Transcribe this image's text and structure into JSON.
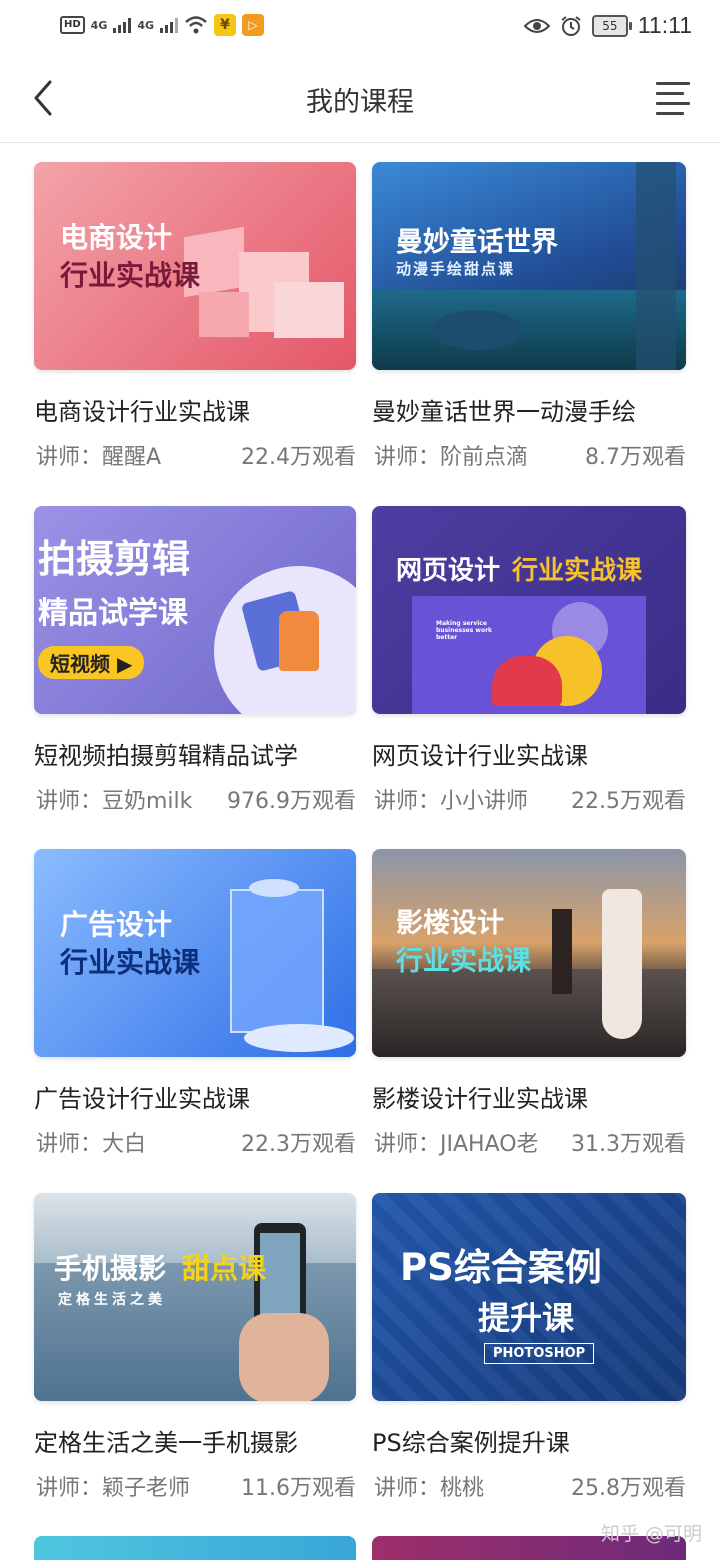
{
  "status_bar": {
    "hd": "HD",
    "sim1": "4G",
    "sim2": "4G",
    "battery": "55",
    "time": "11:11",
    "icons": [
      "hd-icon",
      "signal-icon",
      "wifi-icon",
      "payment-icon",
      "play-icon",
      "eye-icon",
      "alarm-icon",
      "battery-icon"
    ]
  },
  "header": {
    "title": "我的课程",
    "back_icon": "back-arrow-icon",
    "menu_icon": "menu-icon"
  },
  "courses": [
    {
      "title": "电商设计行业实战课",
      "lecturer": "讲师：醒醒A",
      "views": "22.4万观看",
      "thumb": {
        "line1": "电商设计",
        "line2": "行业实战课",
        "colors": [
          "#f08d94",
          "#e75d6c"
        ]
      }
    },
    {
      "title": "曼妙童话世界一动漫手绘",
      "lecturer": "讲师：阶前点滴",
      "views": "8.7万观看",
      "thumb": {
        "line1": "曼妙童话世界",
        "line2": "动漫手绘甜点课",
        "colors": [
          "#2d6fc4",
          "#1a3f7a"
        ]
      }
    },
    {
      "title": "短视频拍摄剪辑精品试学",
      "lecturer": "讲师：豆奶milk",
      "views": "976.9万观看",
      "thumb": {
        "line1": "拍摄剪辑",
        "line2": "精品试学课",
        "badge": "短视频 ▶",
        "colors": [
          "#8d86dc",
          "#6c64c8"
        ]
      }
    },
    {
      "title": "网页设计行业实战课",
      "lecturer": "讲师：小小讲师",
      "views": "22.5万观看",
      "thumb": {
        "line1a": "网页设计",
        "line1b": "行业实战课",
        "mock_text": "Making service businesses work better",
        "colors": [
          "#4a3c9a",
          "#3a2d85"
        ]
      }
    },
    {
      "title": "广告设计行业实战课",
      "lecturer": "讲师：大白",
      "views": "22.3万观看",
      "thumb": {
        "line1": "广告设计",
        "line2": "行业实战课",
        "colors": [
          "#6aa6ff",
          "#2d70e6"
        ]
      }
    },
    {
      "title": "影楼设计行业实战课",
      "lecturer": "讲师：JIAHAO老",
      "views": "31.3万观看",
      "thumb": {
        "line1": "影楼设计",
        "line2": "行业实战课",
        "colors": [
          "#8a97a8",
          "#3f3a3a"
        ]
      }
    },
    {
      "title": "定格生活之美一手机摄影",
      "lecturer": "讲师：颖子老师",
      "views": "11.6万观看",
      "thumb": {
        "line1a": "手机摄影",
        "line1b": "甜点课",
        "line2": "定格生活之美",
        "colors": [
          "#a7b9c6",
          "#6f8fa6"
        ]
      }
    },
    {
      "title": "PS综合案例提升课",
      "lecturer": "讲师：桃桃",
      "views": "25.8万观看",
      "thumb": {
        "line1": "PS综合案例",
        "line2": "提升课",
        "badge": "PHOTOSHOP",
        "colors": [
          "#1f4f9e",
          "#12306b"
        ]
      }
    }
  ],
  "watermark": "知乎 @可明"
}
